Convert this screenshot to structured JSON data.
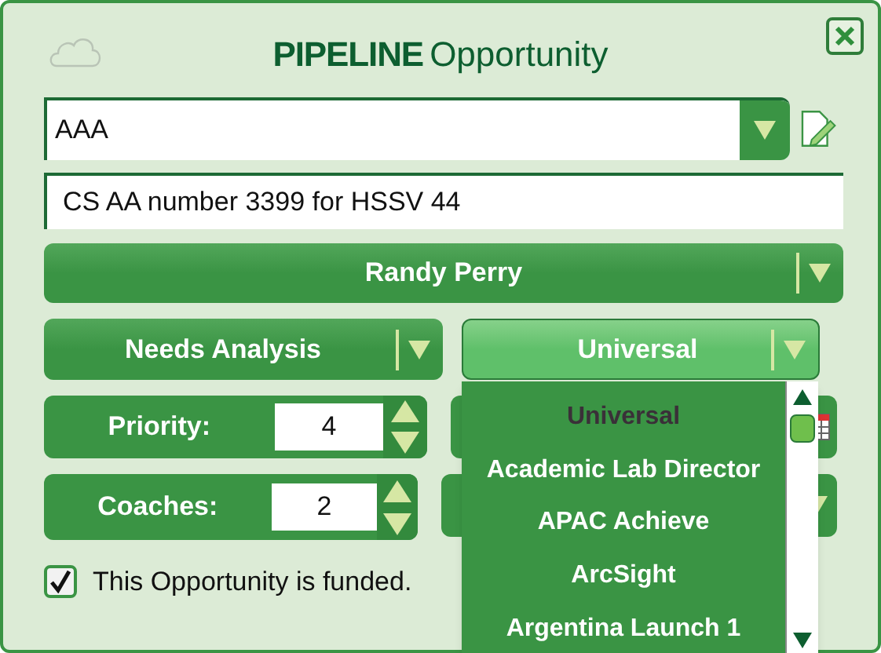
{
  "window": {
    "title_bold": "PIPELINE",
    "title": "Opportunity"
  },
  "account_field": {
    "value": "AAA"
  },
  "description_field": {
    "value": "CS AA number 3399 for HSSV 44"
  },
  "owner_dropdown": {
    "value": "Randy Perry"
  },
  "stage_dropdown": {
    "value": "Needs Analysis"
  },
  "type_dropdown": {
    "value": "Universal",
    "expanded": true,
    "options": [
      {
        "label": "Universal",
        "selected": true
      },
      {
        "label": "Academic Lab Director",
        "selected": false
      },
      {
        "label": "APAC Achieve",
        "selected": false
      },
      {
        "label": "ArcSight",
        "selected": false
      },
      {
        "label": "Argentina Launch 1",
        "selected": false
      }
    ]
  },
  "priority": {
    "label": "Priority:",
    "value": "4"
  },
  "coaches": {
    "label": "Coaches:",
    "value": "2"
  },
  "funded": {
    "label": "This Opportunity is funded.",
    "checked": true
  }
}
